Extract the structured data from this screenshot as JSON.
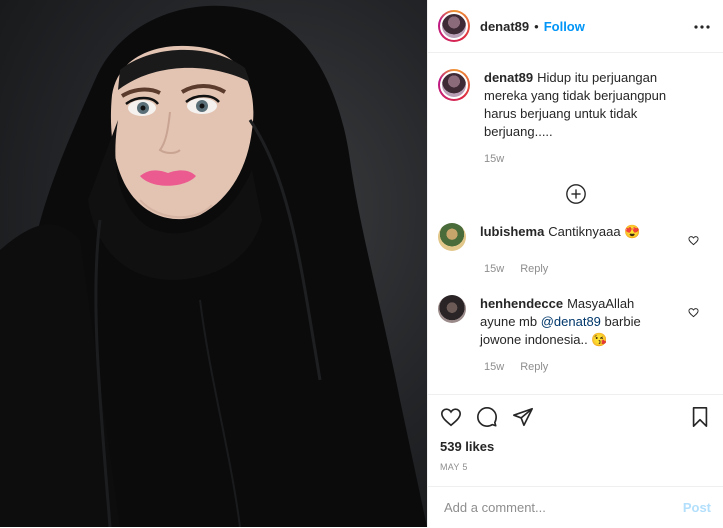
{
  "post": {
    "username": "denat89",
    "follow_label": "Follow",
    "separator": "•",
    "more_icon": "ellipsis-icon"
  },
  "caption": {
    "username": "denat89",
    "text": "Hidup itu perjuangan mereka yang tidak berjuangpun harus berjuang untuk tidak berjuang.....",
    "time": "15w"
  },
  "comments": [
    {
      "username": "lubishema",
      "text": "Cantiknyaaa",
      "emoji": "😍",
      "time": "15w",
      "reply_label": "Reply"
    },
    {
      "username": "henhendecce",
      "text_before": "MasyaAllah ayune mb",
      "mention": "@denat89",
      "text_after": "barbie jowone indonesia..",
      "emoji": "😘",
      "time": "15w",
      "reply_label": "Reply"
    }
  ],
  "likes": "539 likes",
  "date": "MAY 5",
  "add_comment": {
    "placeholder": "Add a comment...",
    "post_label": "Post"
  },
  "colors": {
    "link": "#0095f6",
    "post_disabled": "#b2dffc",
    "muted": "#8e8e8e"
  }
}
